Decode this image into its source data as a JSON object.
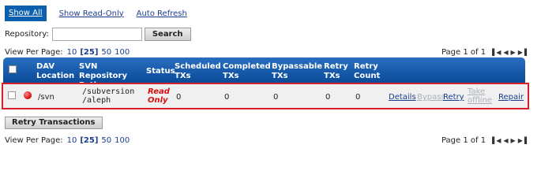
{
  "filters": {
    "show_all": "Show All",
    "show_read_only": "Show Read-Only",
    "auto_refresh": "Auto Refresh"
  },
  "search": {
    "label": "Repository:",
    "value": "",
    "placeholder": "",
    "button": "Search"
  },
  "paging": {
    "label": "View Per Page:",
    "options": [
      "10",
      "[25]",
      "50",
      "100"
    ],
    "page_text": "Page 1 of 1",
    "nav_icons": [
      "first-page-icon",
      "prev-page-icon",
      "next-page-icon",
      "last-page-icon"
    ]
  },
  "table": {
    "headers": {
      "dav_location": "DAV Location",
      "svn_path": "SVN Repository Path",
      "status": "Status",
      "scheduled": "Scheduled TXs",
      "completed": "Completed TXs",
      "bypassable": "Bypassable TXs",
      "retry_txs": "Retry TXs",
      "retry_count": "Retry Count"
    },
    "rows": [
      {
        "dav_location": "/svn",
        "svn_path_line1": "/subversion",
        "svn_path_line2": "/aleph",
        "status_line1": "Read",
        "status_line2": "Only",
        "scheduled": "0",
        "completed": "0",
        "bypassable": "0",
        "retry_txs": "0",
        "retry_count": "0",
        "actions": {
          "details": "Details",
          "bypass": "Bypass",
          "retry": "Retry",
          "take_offline_line1": "Take",
          "take_offline_line2": "offline",
          "repair": "Repair"
        }
      }
    ]
  },
  "retry_transactions_button": "Retry Transactions",
  "colors": {
    "header_blue": "#0a5fae",
    "highlight_red": "#d91f2a",
    "status_red": "#d80f0f",
    "link_blue": "#1a3d8f",
    "disabled": "#aab0bb"
  }
}
